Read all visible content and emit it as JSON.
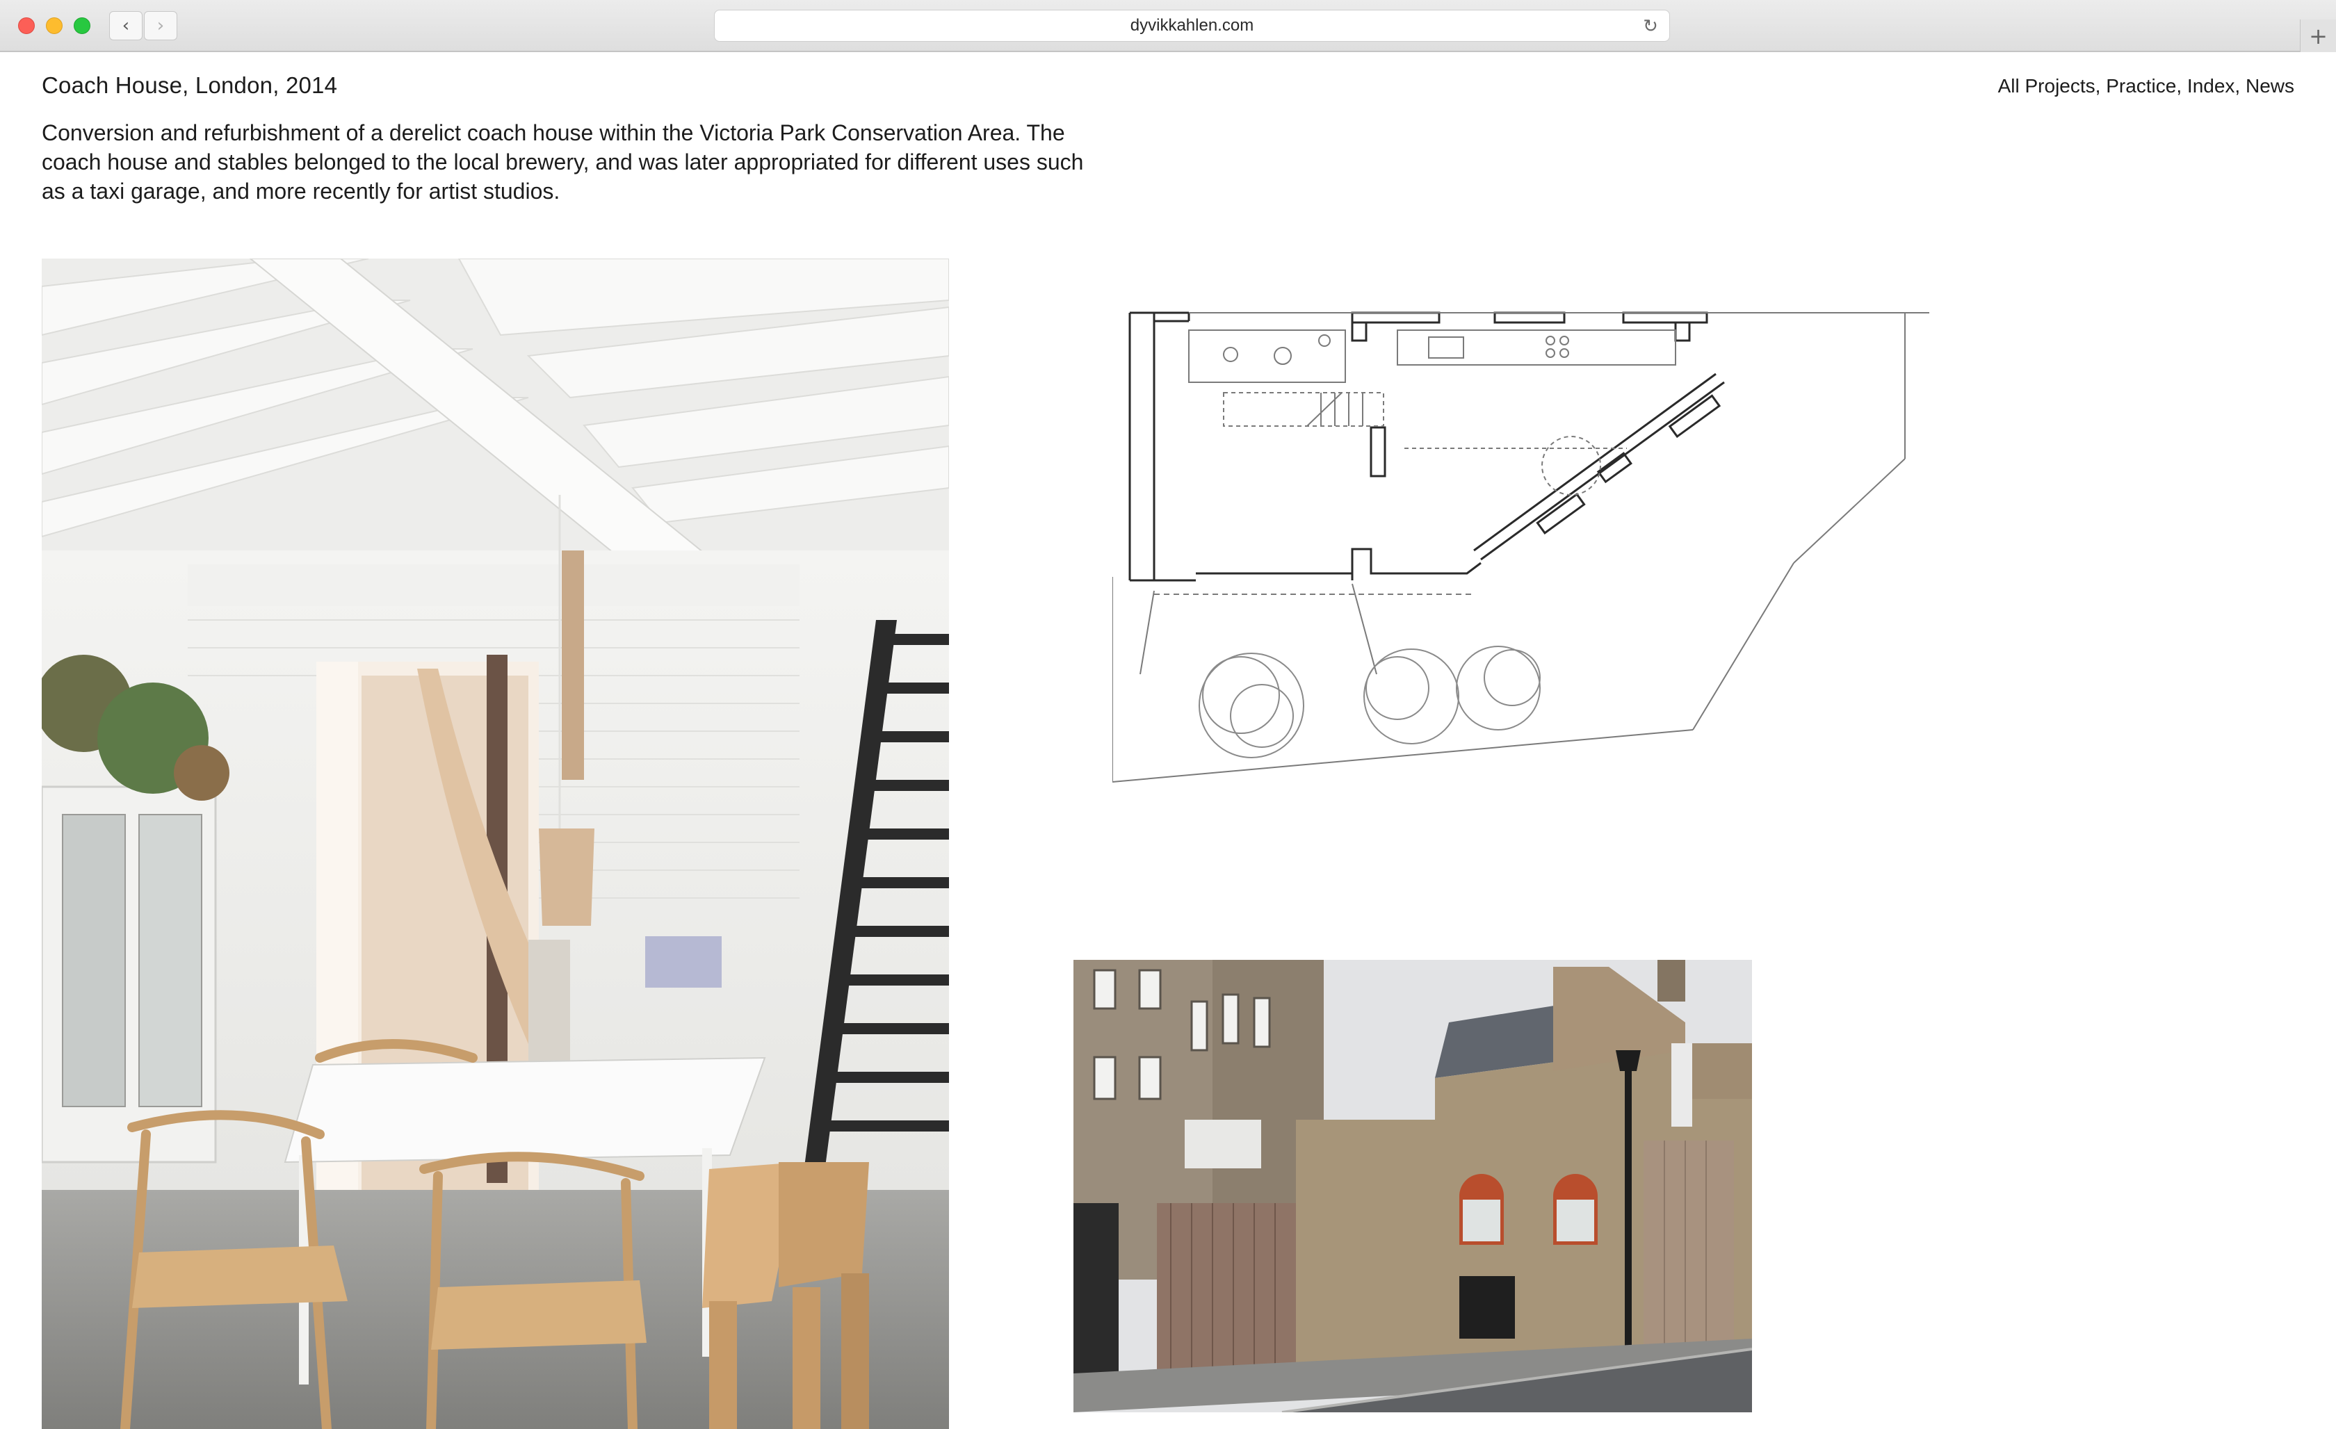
{
  "browser": {
    "url": "dyvikkahlen.com",
    "back_icon": "chevron-left-icon",
    "forward_icon": "chevron-right-icon",
    "reload_icon": "reload-icon",
    "new_tab_icon": "plus-icon"
  },
  "page": {
    "project_title": "Coach House, London, 2014",
    "description": "Conversion and refurbishment of a derelict coach house within the Victoria Park Conservation Area. The coach house and stables belonged to the local brewery, and was later appropriated for different uses such as a taxi garage, and more recently for artist studios.",
    "nav": {
      "all_projects": "All Projects",
      "practice": "Practice",
      "index": "Index",
      "news": "News",
      "separator": ", "
    }
  },
  "colors": {
    "chrome_bg": "#e4e4e4",
    "text": "#1c1c1c",
    "close": "#fc5f57",
    "minimize": "#fdbc2e",
    "maximize": "#28c840"
  }
}
